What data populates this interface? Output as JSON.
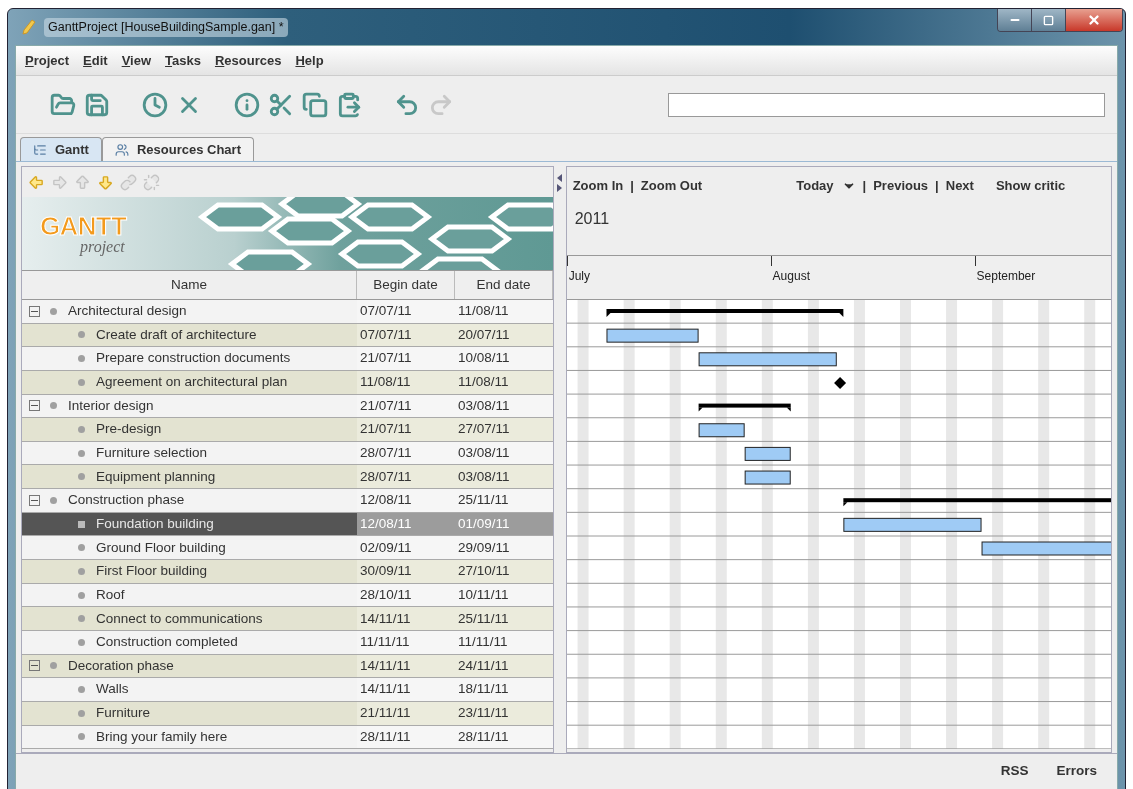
{
  "window": {
    "title": "GanttProject [HouseBuildingSample.gan] *"
  },
  "menu": [
    "Project",
    "Edit",
    "View",
    "Tasks",
    "Resources",
    "Help"
  ],
  "toolbar": [
    {
      "kind": "open",
      "disabled": false
    },
    {
      "kind": "save",
      "disabled": false
    },
    {
      "kind": "clock",
      "disabled": false
    },
    {
      "kind": "delete",
      "disabled": false
    },
    {
      "kind": "info",
      "disabled": false
    },
    {
      "kind": "cut",
      "disabled": false
    },
    {
      "kind": "copy",
      "disabled": false
    },
    {
      "kind": "paste",
      "disabled": false
    },
    {
      "kind": "undo",
      "disabled": false
    },
    {
      "kind": "redo",
      "disabled": true
    }
  ],
  "tabs": [
    {
      "label": "Gantt",
      "selected": true
    },
    {
      "label": "Resources Chart",
      "selected": false
    }
  ],
  "task_toolbar": [
    {
      "kind": "left",
      "disabled": false
    },
    {
      "kind": "right",
      "disabled": true
    },
    {
      "kind": "up",
      "disabled": true
    },
    {
      "kind": "down",
      "disabled": false
    },
    {
      "kind": "link",
      "disabled": true
    },
    {
      "kind": "unlink",
      "disabled": true
    }
  ],
  "logo": {
    "text": "GANTT",
    "subtitle": "project"
  },
  "table": {
    "columns": [
      "Name",
      "Begin date",
      "End date"
    ],
    "tasks": [
      {
        "name": "Architectural design",
        "begin": "07/07/11",
        "end": "11/08/11",
        "selected": false,
        "expanded": true,
        "children": [
          {
            "name": "Create draft of architecture",
            "begin": "07/07/11",
            "end": "20/07/11",
            "selected": false
          },
          {
            "name": "Prepare construction documents",
            "begin": "21/07/11",
            "end": "10/08/11",
            "selected": false
          },
          {
            "name": "Agreement on architectural plan",
            "begin": "11/08/11",
            "end": "11/08/11",
            "selected": false
          }
        ]
      },
      {
        "name": "Interior design",
        "begin": "21/07/11",
        "end": "03/08/11",
        "selected": false,
        "expanded": true,
        "children": [
          {
            "name": "Pre-design",
            "begin": "21/07/11",
            "end": "27/07/11",
            "selected": false
          },
          {
            "name": "Furniture selection",
            "begin": "28/07/11",
            "end": "03/08/11",
            "selected": false
          },
          {
            "name": "Equipment planning",
            "begin": "28/07/11",
            "end": "03/08/11",
            "selected": false
          }
        ]
      },
      {
        "name": "Construction phase",
        "begin": "12/08/11",
        "end": "25/11/11",
        "selected": false,
        "expanded": true,
        "children": [
          {
            "name": "Foundation building",
            "begin": "12/08/11",
            "end": "01/09/11",
            "selected": true
          },
          {
            "name": "Ground Floor building",
            "begin": "02/09/11",
            "end": "29/09/11",
            "selected": false
          },
          {
            "name": "First Floor building",
            "begin": "30/09/11",
            "end": "27/10/11",
            "selected": false
          },
          {
            "name": "Roof",
            "begin": "28/10/11",
            "end": "10/11/11",
            "selected": false
          },
          {
            "name": "Connect to communications",
            "begin": "14/11/11",
            "end": "25/11/11",
            "selected": false
          },
          {
            "name": "Construction completed",
            "begin": "11/11/11",
            "end": "11/11/11",
            "selected": false
          }
        ]
      },
      {
        "name": "Decoration phase",
        "begin": "14/11/11",
        "end": "24/11/11",
        "selected": false,
        "expanded": true,
        "children": [
          {
            "name": "Walls",
            "begin": "14/11/11",
            "end": "18/11/11",
            "selected": false
          },
          {
            "name": "Furniture",
            "begin": "21/11/11",
            "end": "23/11/11",
            "selected": false
          },
          {
            "name": "Bring your family here",
            "begin": "28/11/11",
            "end": "28/11/11",
            "selected": false
          }
        ]
      }
    ]
  },
  "chart_toolbar": [
    {
      "kind": "link",
      "label": "Zoom In"
    },
    {
      "kind": "separator",
      "label": "|"
    },
    {
      "kind": "link",
      "label": "Zoom Out"
    },
    {
      "kind": "spacer"
    },
    {
      "kind": "dropdown",
      "label": "Today"
    },
    {
      "kind": "separator",
      "label": "|"
    },
    {
      "kind": "link",
      "label": "Previous"
    },
    {
      "kind": "separator",
      "label": "|"
    },
    {
      "kind": "link",
      "label": "Next"
    },
    {
      "kind": "link",
      "label": "Show critic"
    }
  ],
  "chart": {
    "year": "2011",
    "months": [
      "July",
      "August",
      "September"
    ]
  },
  "status_bar": [
    "RSS",
    "Errors"
  ]
}
